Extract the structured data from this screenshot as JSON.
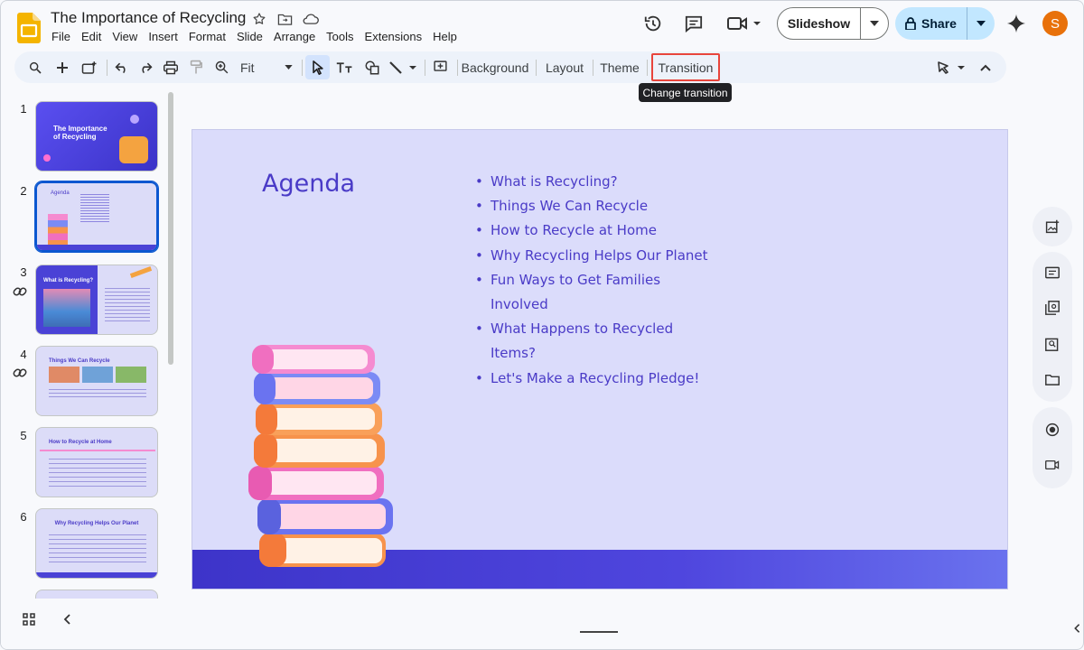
{
  "app": {
    "doc_title": "The Importance of Recycling",
    "menu": [
      "File",
      "Edit",
      "View",
      "Insert",
      "Format",
      "Slide",
      "Arrange",
      "Tools",
      "Extensions",
      "Help"
    ],
    "slideshow_label": "Slideshow",
    "share_label": "Share",
    "avatar_letter": "S",
    "accent": "#0b57d0",
    "share_bg": "#c2e7ff"
  },
  "toolbar": {
    "zoom": "Fit",
    "background": "Background",
    "layout": "Layout",
    "theme": "Theme",
    "transition": "Transition",
    "tooltip": "Change transition"
  },
  "filmstrip": {
    "slides": [
      {
        "num": "1",
        "title": "The Importance of Recycling"
      },
      {
        "num": "2",
        "title": "Agenda"
      },
      {
        "num": "3",
        "title": "What is Recycling?"
      },
      {
        "num": "4",
        "title": "Things We Can Recycle"
      },
      {
        "num": "5",
        "title": "How to Recycle at Home"
      },
      {
        "num": "6",
        "title": "Why Recycling Helps Our Planet"
      }
    ]
  },
  "slide": {
    "title": "Agenda",
    "items": [
      "What is Recycling?",
      "Things We Can Recycle",
      "How to Recycle at Home",
      "Why Recycling Helps Our Planet",
      "Fun Ways to Get Families Involved",
      "What Happens to Recycled Items?",
      "Let's Make a Recycling Pledge!"
    ],
    "title_color": "#4a3bc7",
    "bg_color": "#dbdcfb"
  }
}
